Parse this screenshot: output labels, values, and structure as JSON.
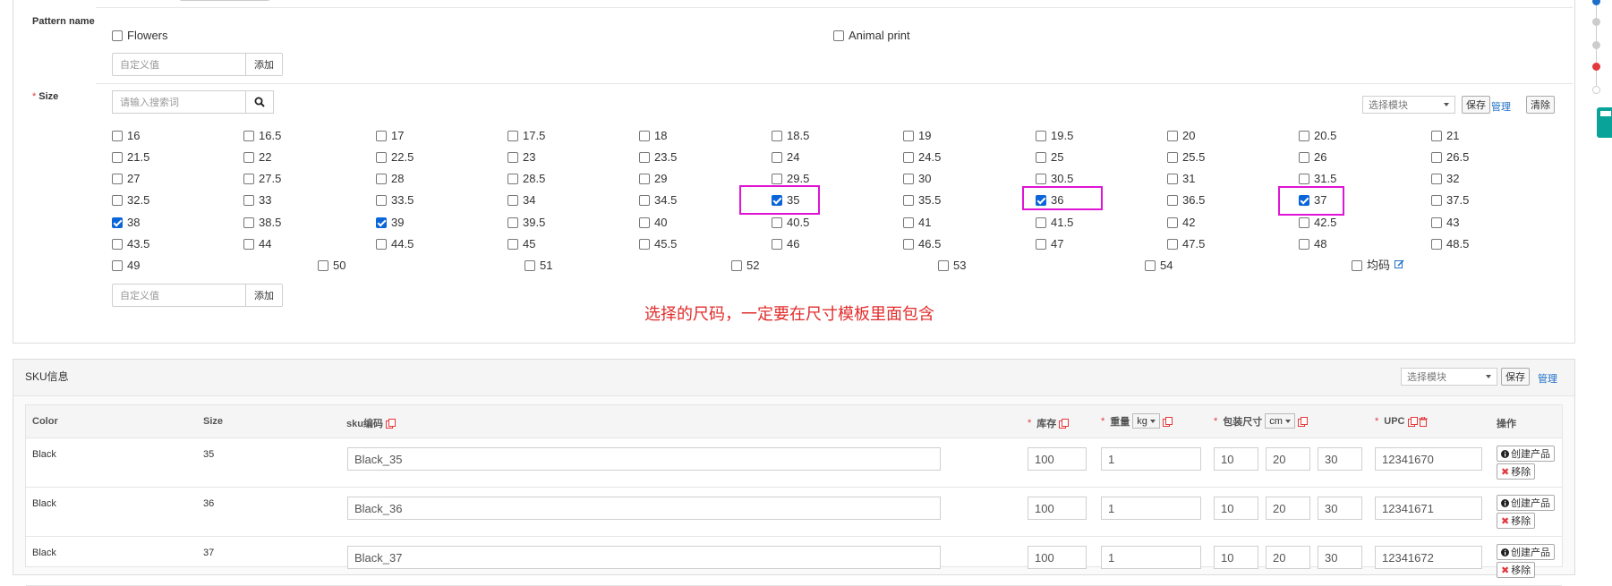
{
  "pattern": {
    "label": "Pattern name",
    "options": [
      {
        "label": "Flowers",
        "checked": false
      },
      {
        "label": "Animal print",
        "checked": false
      }
    ],
    "custom_placeholder": "自定义值",
    "add_label": "添加"
  },
  "size": {
    "label": "Size",
    "required_mark": "*",
    "search_placeholder": "请输入搜索词",
    "template_select": "选择模块",
    "save_label": "保存",
    "manage_label": "管理",
    "clear_label": "清除",
    "options": [
      {
        "label": "16",
        "checked": false
      },
      {
        "label": "16.5",
        "checked": false
      },
      {
        "label": "17",
        "checked": false
      },
      {
        "label": "17.5",
        "checked": false
      },
      {
        "label": "18",
        "checked": false
      },
      {
        "label": "18.5",
        "checked": false
      },
      {
        "label": "19",
        "checked": false
      },
      {
        "label": "19.5",
        "checked": false
      },
      {
        "label": "20",
        "checked": false
      },
      {
        "label": "20.5",
        "checked": false
      },
      {
        "label": "21",
        "checked": false
      },
      {
        "label": "21.5",
        "checked": false
      },
      {
        "label": "22",
        "checked": false
      },
      {
        "label": "22.5",
        "checked": false
      },
      {
        "label": "23",
        "checked": false
      },
      {
        "label": "23.5",
        "checked": false
      },
      {
        "label": "24",
        "checked": false
      },
      {
        "label": "24.5",
        "checked": false
      },
      {
        "label": "25",
        "checked": false
      },
      {
        "label": "25.5",
        "checked": false
      },
      {
        "label": "26",
        "checked": false
      },
      {
        "label": "26.5",
        "checked": false
      },
      {
        "label": "27",
        "checked": false
      },
      {
        "label": "27.5",
        "checked": false
      },
      {
        "label": "28",
        "checked": false
      },
      {
        "label": "28.5",
        "checked": false
      },
      {
        "label": "29",
        "checked": false
      },
      {
        "label": "29.5",
        "checked": false
      },
      {
        "label": "30",
        "checked": false
      },
      {
        "label": "30.5",
        "checked": false
      },
      {
        "label": "31",
        "checked": false
      },
      {
        "label": "31.5",
        "checked": false
      },
      {
        "label": "32",
        "checked": false
      },
      {
        "label": "32.5",
        "checked": false
      },
      {
        "label": "33",
        "checked": false
      },
      {
        "label": "33.5",
        "checked": false
      },
      {
        "label": "34",
        "checked": false
      },
      {
        "label": "34.5",
        "checked": false
      },
      {
        "label": "35",
        "checked": true
      },
      {
        "label": "35.5",
        "checked": false
      },
      {
        "label": "36",
        "checked": true
      },
      {
        "label": "36.5",
        "checked": false
      },
      {
        "label": "37",
        "checked": true
      },
      {
        "label": "37.5",
        "checked": false
      },
      {
        "label": "38",
        "checked": true
      },
      {
        "label": "38.5",
        "checked": false
      },
      {
        "label": "39",
        "checked": true
      },
      {
        "label": "39.5",
        "checked": false
      },
      {
        "label": "40",
        "checked": false
      },
      {
        "label": "40.5",
        "checked": false
      },
      {
        "label": "41",
        "checked": false
      },
      {
        "label": "41.5",
        "checked": false
      },
      {
        "label": "42",
        "checked": false
      },
      {
        "label": "42.5",
        "checked": false
      },
      {
        "label": "43",
        "checked": false
      },
      {
        "label": "43.5",
        "checked": false
      },
      {
        "label": "44",
        "checked": false
      },
      {
        "label": "44.5",
        "checked": false
      },
      {
        "label": "45",
        "checked": false
      },
      {
        "label": "45.5",
        "checked": false
      },
      {
        "label": "46",
        "checked": false
      },
      {
        "label": "46.5",
        "checked": false
      },
      {
        "label": "47",
        "checked": false
      },
      {
        "label": "47.5",
        "checked": false
      },
      {
        "label": "48",
        "checked": false
      },
      {
        "label": "48.5",
        "checked": false
      }
    ],
    "last_row": [
      {
        "label": "49",
        "checked": false
      },
      {
        "label": "50",
        "checked": false
      },
      {
        "label": "51",
        "checked": false
      },
      {
        "label": "52",
        "checked": false
      },
      {
        "label": "53",
        "checked": false
      },
      {
        "label": "54",
        "checked": false
      },
      {
        "label": "均码",
        "checked": false
      }
    ],
    "custom_placeholder": "自定义值",
    "add_label": "添加",
    "note": "选择的尺码，一定要在尺寸模板里面包含"
  },
  "sku": {
    "title": "SKU信息",
    "template_select": "选择模块",
    "save_label": "保存",
    "manage_label": "管理",
    "columns": {
      "color": "Color",
      "size": "Size",
      "sku_code": "sku编码",
      "stock": "库存",
      "weight": "重量",
      "weight_unit": "kg",
      "package": "包装尺寸",
      "package_unit": "cm",
      "upc": "UPC",
      "actions": "操作",
      "required_mark": "*"
    },
    "rows": [
      {
        "color": "Black",
        "size": "35",
        "sku": "Black_35",
        "stock": "100",
        "weight": "1",
        "l": "10",
        "w": "20",
        "h": "30",
        "upc": "12341670"
      },
      {
        "color": "Black",
        "size": "36",
        "sku": "Black_36",
        "stock": "100",
        "weight": "1",
        "l": "10",
        "w": "20",
        "h": "30",
        "upc": "12341671"
      },
      {
        "color": "Black",
        "size": "37",
        "sku": "Black_37",
        "stock": "100",
        "weight": "1",
        "l": "10",
        "w": "20",
        "h": "30",
        "upc": "12341672"
      }
    ],
    "create_label": "创建产品",
    "remove_label": "移除"
  },
  "colors": {
    "accent": "#1e6fc8",
    "required": "#e4393c",
    "highlight": "#e014d6",
    "note": "#e22c2c",
    "timeline_active": "#1e6fc8",
    "timeline_error": "#e4393c",
    "calculator": "#0aa39a"
  }
}
